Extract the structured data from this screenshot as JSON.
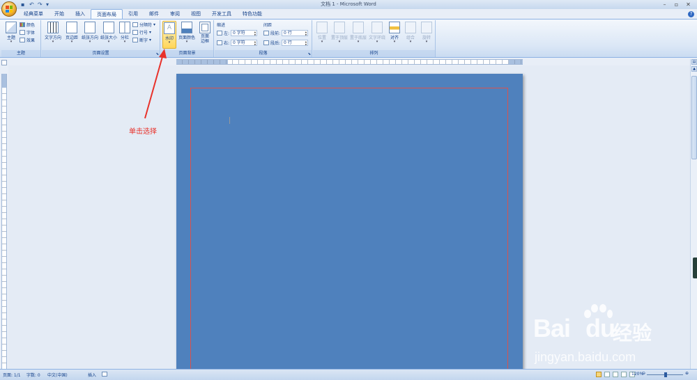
{
  "window": {
    "title": "文档 1 - Microsoft Word"
  },
  "tabs": [
    "经典菜单",
    "开始",
    "插入",
    "页面布局",
    "引用",
    "邮件",
    "审阅",
    "视图",
    "开发工具",
    "特色功能"
  ],
  "active_tab": "页面布局",
  "ribbon": {
    "themes": {
      "label": "主题",
      "theme_btn": "主题",
      "colors": "颜色",
      "fonts": "字体",
      "effects": "效果"
    },
    "page_setup": {
      "label": "页面设置",
      "text_direction": "文字方向",
      "margins": "页边距",
      "orientation": "纸张方向",
      "size": "纸张大小",
      "columns": "分栏",
      "breaks": "分隔符",
      "line_numbers": "行号",
      "hyphenation": "断字"
    },
    "page_background": {
      "label": "页面背景",
      "watermark": "水印",
      "page_color": "页面颜色",
      "page_borders": "页面边框"
    },
    "paragraph": {
      "label": "段落",
      "indent_title": "缩进",
      "spacing_title": "间距",
      "left_label": "左:",
      "right_label": "右:",
      "left_value": "0 字符",
      "right_value": "0 字符",
      "before_label": "段前:",
      "after_label": "段后:",
      "before_value": "0 行",
      "after_value": "0 行"
    },
    "arrange": {
      "label": "排列",
      "position": "位置",
      "bring_front": "置于顶层",
      "send_back": "置于底层",
      "text_wrap": "文字环绕",
      "align": "对齐",
      "group": "组合",
      "rotate": "旋转"
    }
  },
  "annotation": {
    "text": "单击选择"
  },
  "status": {
    "page": "页面: 1/1",
    "words": "字数: 0",
    "language": "中文(中国)",
    "mode": "插入",
    "zoom": "120%"
  },
  "watermark_logo": {
    "brand": "Bai",
    "brand2": "du",
    "cn": "经验",
    "url": "jingyan.baidu.com"
  },
  "colors": {
    "page": "#4f81bd",
    "annotation": "#e8312a",
    "ribbon_accent": "#15428b"
  }
}
